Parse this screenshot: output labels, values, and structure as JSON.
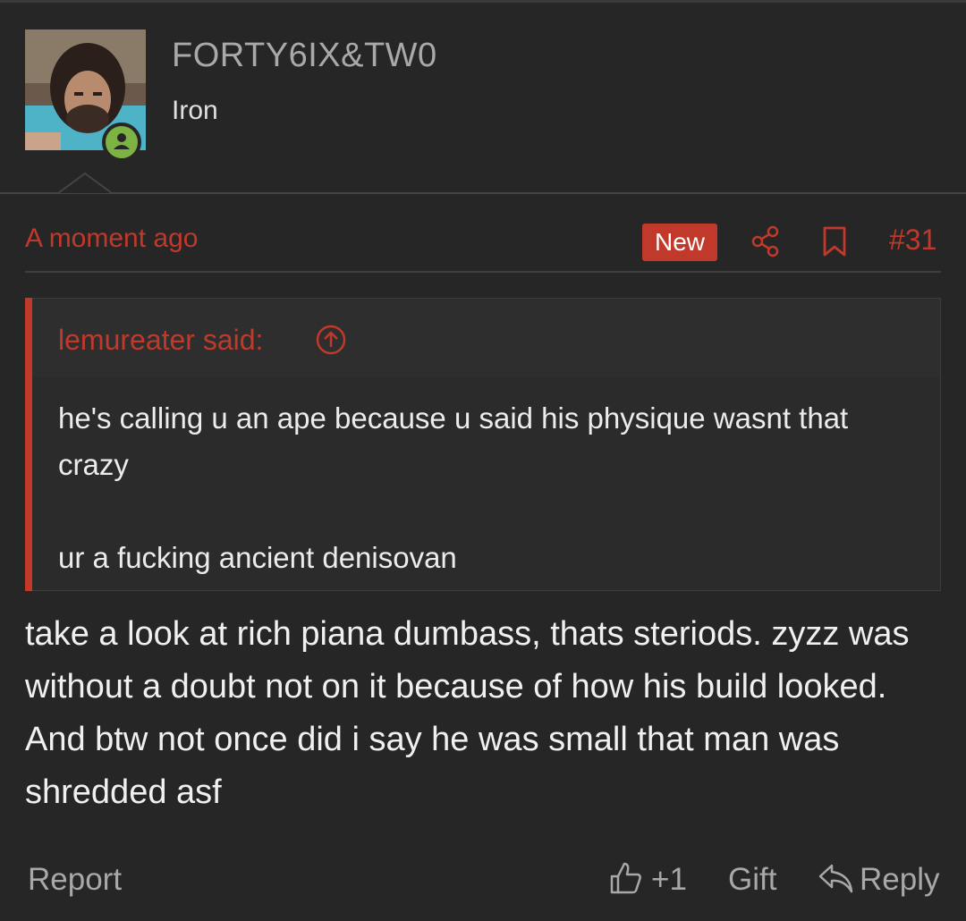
{
  "user": {
    "name": "FORTY6IX&TW0",
    "title": "Iron"
  },
  "post": {
    "time": "A moment ago",
    "badge": "New",
    "number": "#31",
    "quote": {
      "author": "lemureater said:",
      "body": "he's calling u an ape because u said his physique wasnt that crazy\n\nur a fucking ancient denisovan"
    },
    "message": "take a look at rich piana dumbass, thats steriods. zyzz was without a doubt not on it because of how his build looked. And btw not once did i say he was small that man was shredded asf"
  },
  "footer": {
    "report": "Report",
    "likes": "+1",
    "gift": "Gift",
    "reply": "Reply"
  },
  "colors": {
    "accent": "#c0392b",
    "background": "#262626",
    "online": "#7cb342"
  }
}
